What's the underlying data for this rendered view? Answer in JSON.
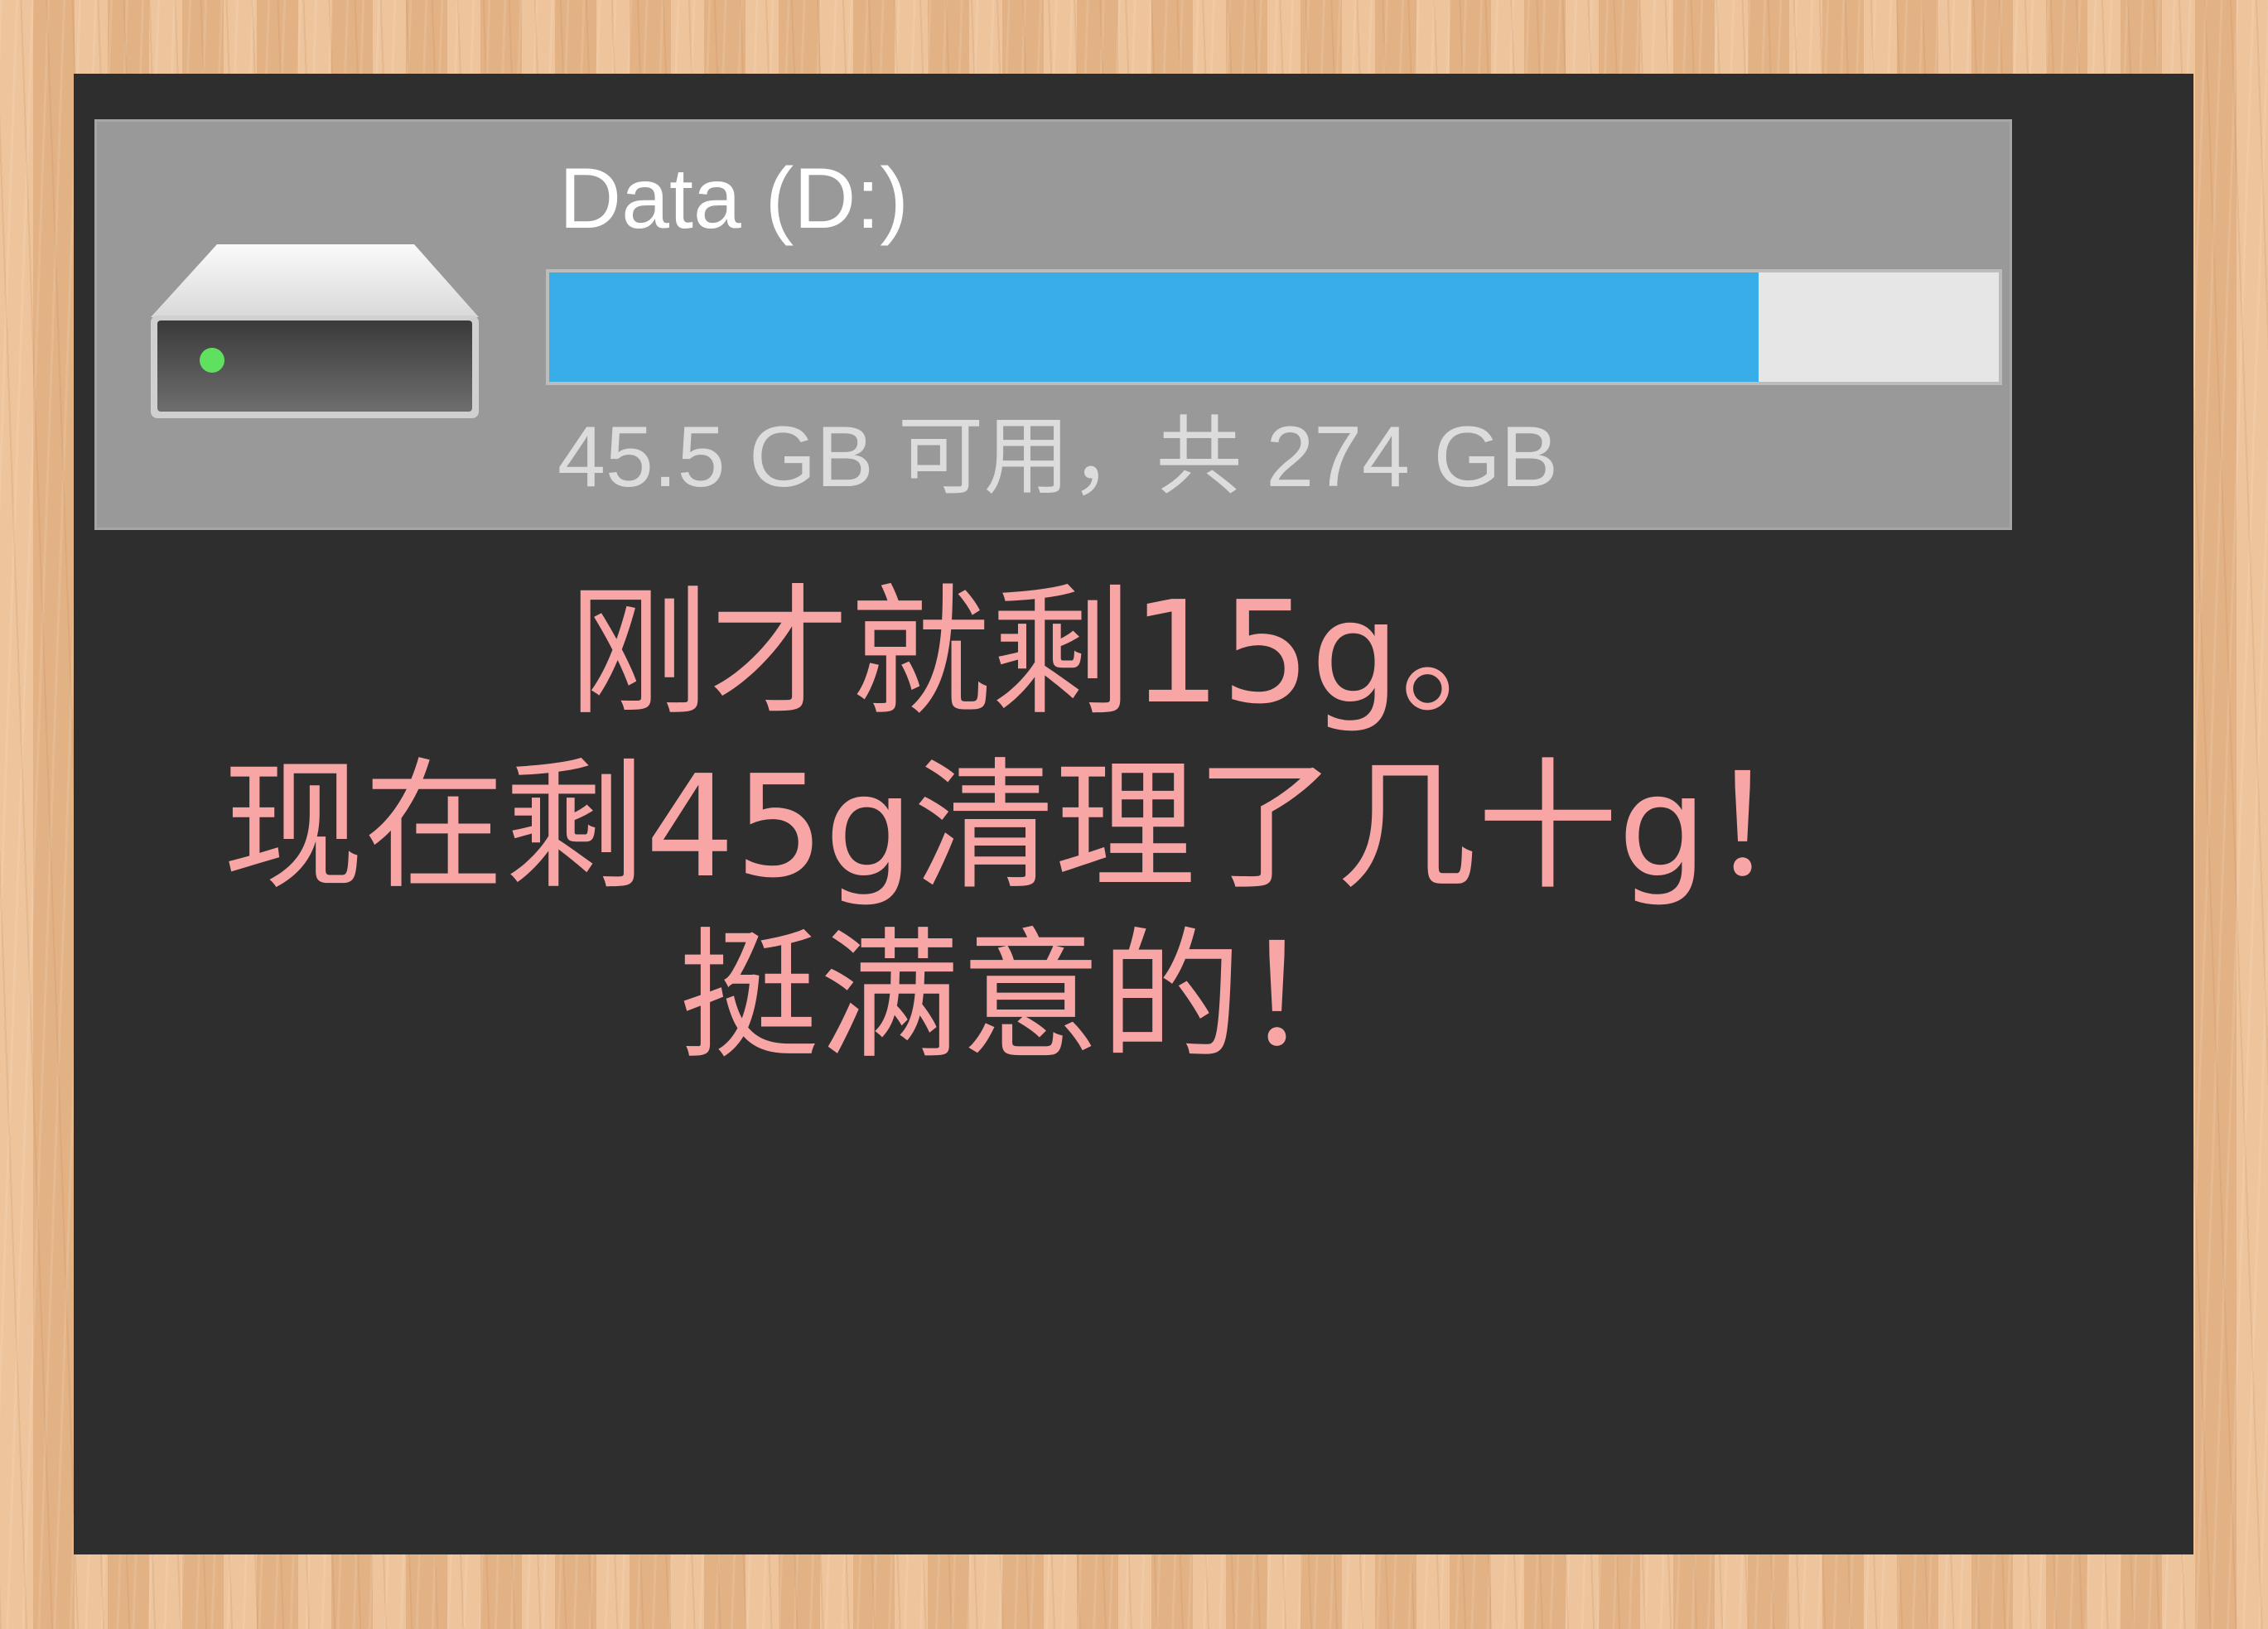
{
  "drive": {
    "name": "Data (D:)",
    "space_text": "45.5 GB 可用，共 274 GB",
    "used_fraction": 0.834,
    "bar_color": "#39ade8",
    "status_light_color": "#5fe05f",
    "icon": "hard-drive-icon"
  },
  "caption": {
    "line1": "刚才就剩15g。",
    "line2": "现在剩45g清理了几十g！",
    "line3": "挺满意的！",
    "color": "#f7a5a5"
  }
}
